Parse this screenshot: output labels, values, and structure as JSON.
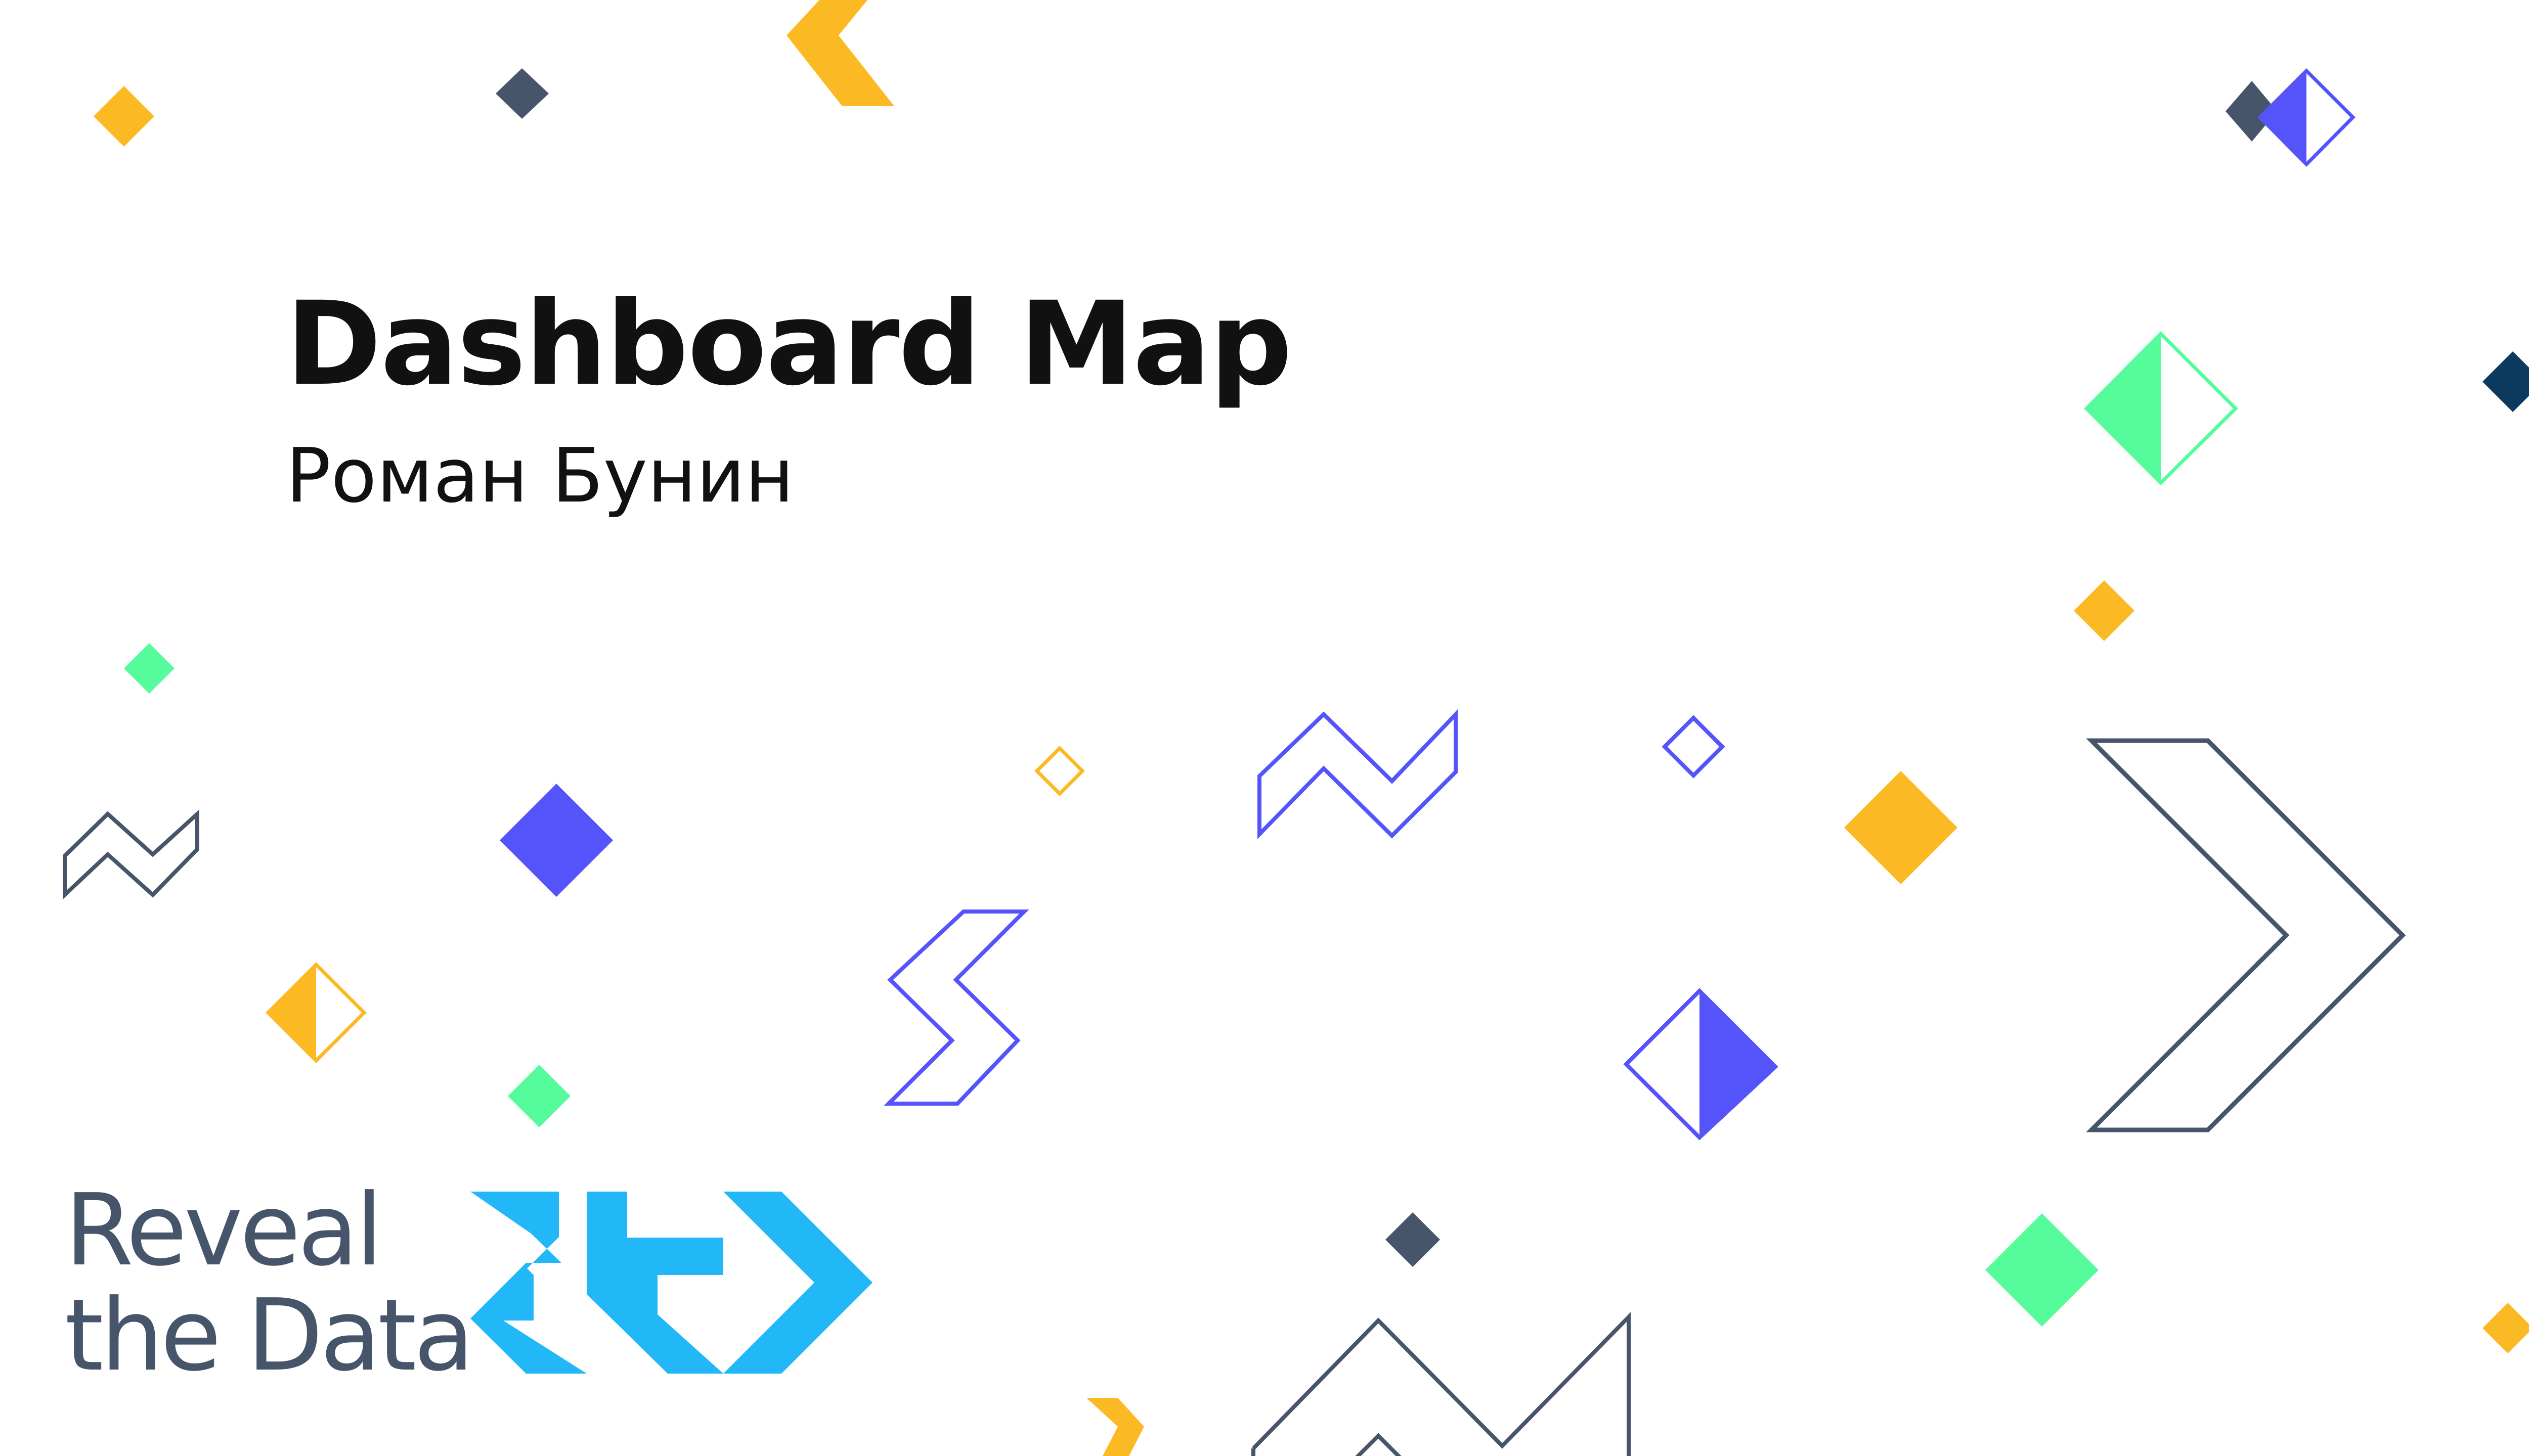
{
  "slide": {
    "title": "Dashboard Map",
    "subtitle": "Роман Бунин",
    "logo": {
      "line1": "Reveal",
      "line2": "the Data"
    }
  },
  "colors": {
    "yellow": "#fbba23",
    "slate": "#47556b",
    "navy": "#0b3a5e",
    "purple": "#5554fb",
    "green": "#56fb9b",
    "logo_blue": "#22b8f7",
    "text": "#111111",
    "background": "#ffffff"
  }
}
